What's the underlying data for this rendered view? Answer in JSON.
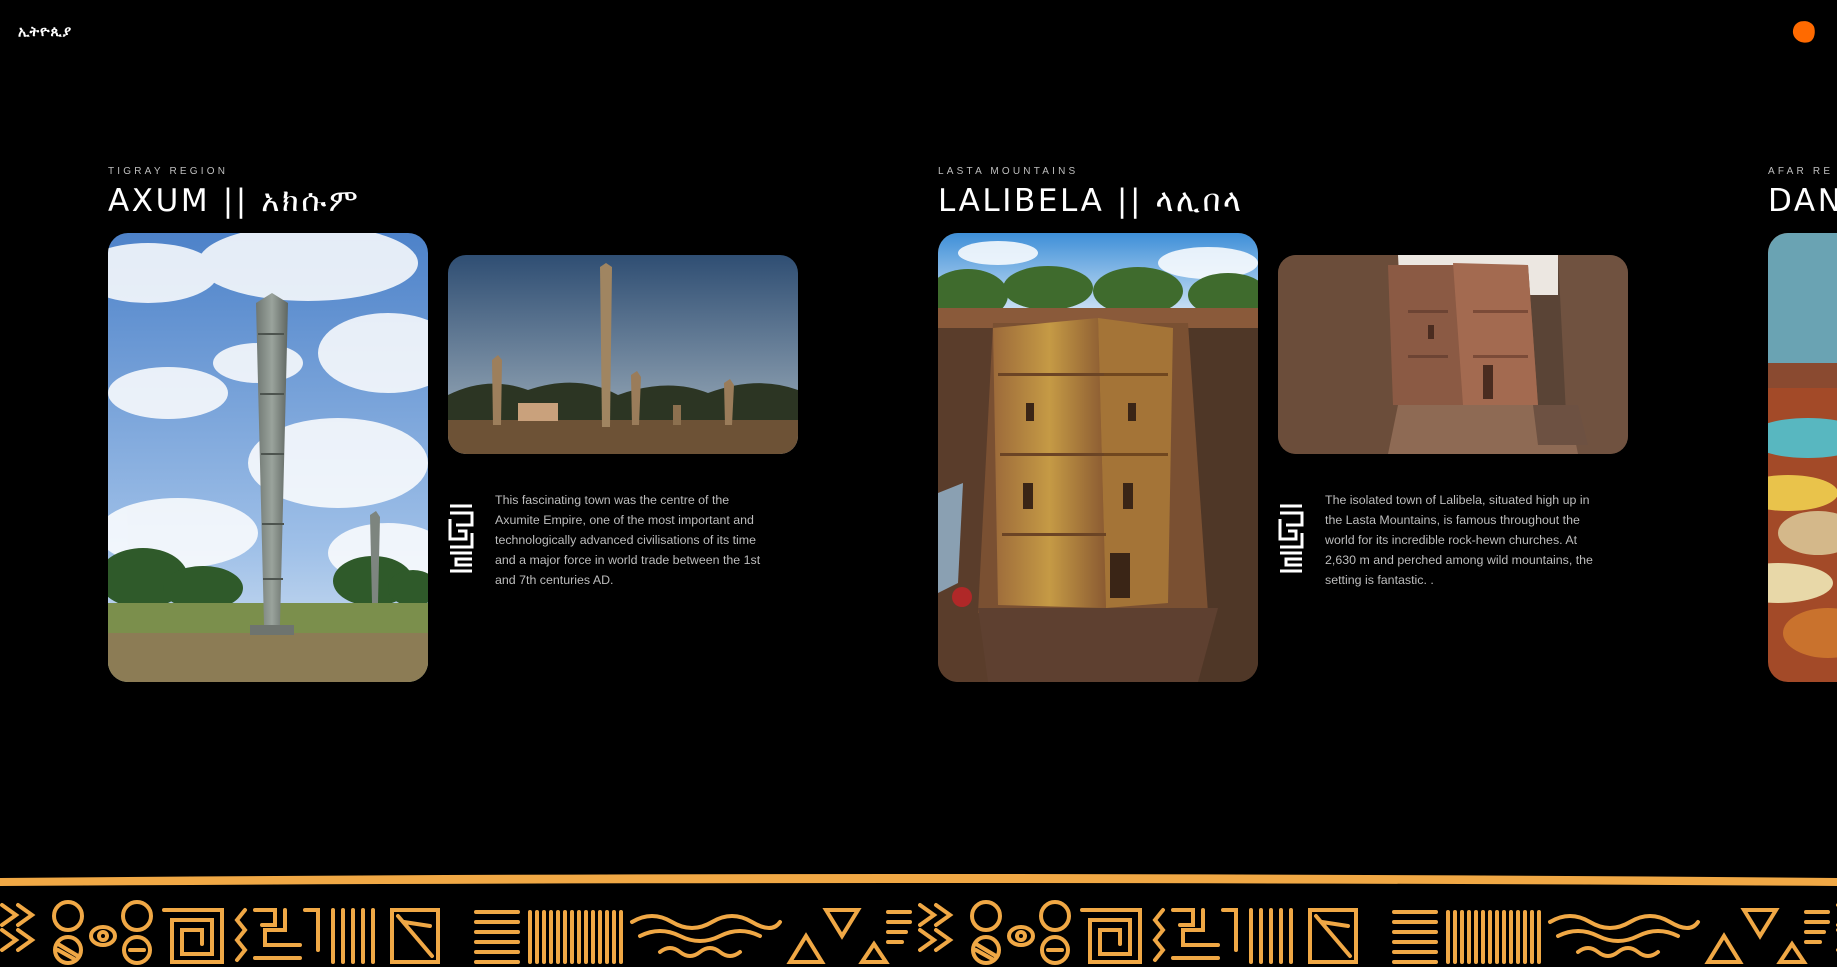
{
  "brand": {
    "logo_text": "ኢትዮጲያ"
  },
  "colors": {
    "accent": "#ff6a00",
    "pattern": "#f0a845",
    "background": "#000000"
  },
  "icons": {
    "menu": "orange-blob-menu-icon",
    "section_mark": "geometric-glyph-icon"
  },
  "destinations": [
    {
      "region": "TIGRAY REGION",
      "title": "AXUM || አክሱም",
      "main_image": "obelisk-under-cloudy-sky",
      "side_image": "obelisk-field-at-dusk",
      "description": "This fascinating town was the centre of the Axumite Empire, one of the most important and technologically advanced civilisations of its time and a major force in world trade between the 1st and 7th centuries AD."
    },
    {
      "region": "LASTA MOUNTAINS",
      "title": "LALIBELA || ላሊበላ",
      "main_image": "rock-hewn-church-aerial",
      "side_image": "rock-hewn-church-trench",
      "description": "The isolated town of Lalibela, situated high up in the Lasta Mountains, is famous throughout the world for its incredible rock-hewn churches. At 2,630 m and perched among wild mountains, the setting is fantastic. ."
    },
    {
      "region": "AFAR RE",
      "title": "DAN",
      "main_image": "danakil-colorful-landscape"
    }
  ],
  "footer": {
    "pattern": "ethiopian-tribal-pattern-band"
  }
}
